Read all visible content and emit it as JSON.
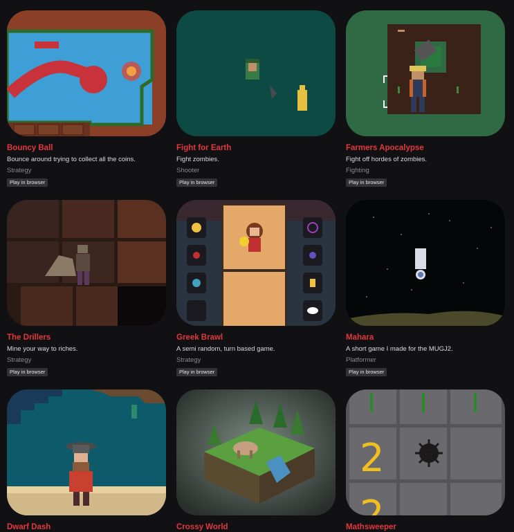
{
  "games": [
    {
      "title": "Bouncy Ball",
      "description": "Bounce around trying to collect all the coins.",
      "genre": "Strategy",
      "platform": "Play in browser"
    },
    {
      "title": "Fight for Earth",
      "description": "Fight zombies.",
      "genre": "Shooter",
      "platform": "Play in browser"
    },
    {
      "title": "Farmers Apocalypse",
      "description": "Fight off hordes of zombies.",
      "genre": "Fighting",
      "platform": "Play in browser"
    },
    {
      "title": "The Drillers",
      "description": "Mine your way to riches.",
      "genre": "Strategy",
      "platform": "Play in browser"
    },
    {
      "title": "Greek Brawl",
      "description": "A semi random, turn based game.",
      "genre": "Strategy",
      "platform": "Play in browser"
    },
    {
      "title": "Mahara",
      "description": "A short game I made for the MUGJ2.",
      "genre": "Platformer",
      "platform": "Play in browser"
    },
    {
      "title": "Dwarf Dash",
      "description": "",
      "genre": "",
      "platform": ""
    },
    {
      "title": "Crossy World",
      "description": "",
      "genre": "",
      "platform": ""
    },
    {
      "title": "Mathsweeper",
      "description": "",
      "genre": "",
      "platform": ""
    }
  ],
  "thumb_texts": {
    "math_a": "2",
    "math_b": "2"
  },
  "colors": {
    "title": "#e2383d",
    "background": "#111113",
    "badge_bg": "#333336",
    "genre": "#8a8a8e"
  }
}
